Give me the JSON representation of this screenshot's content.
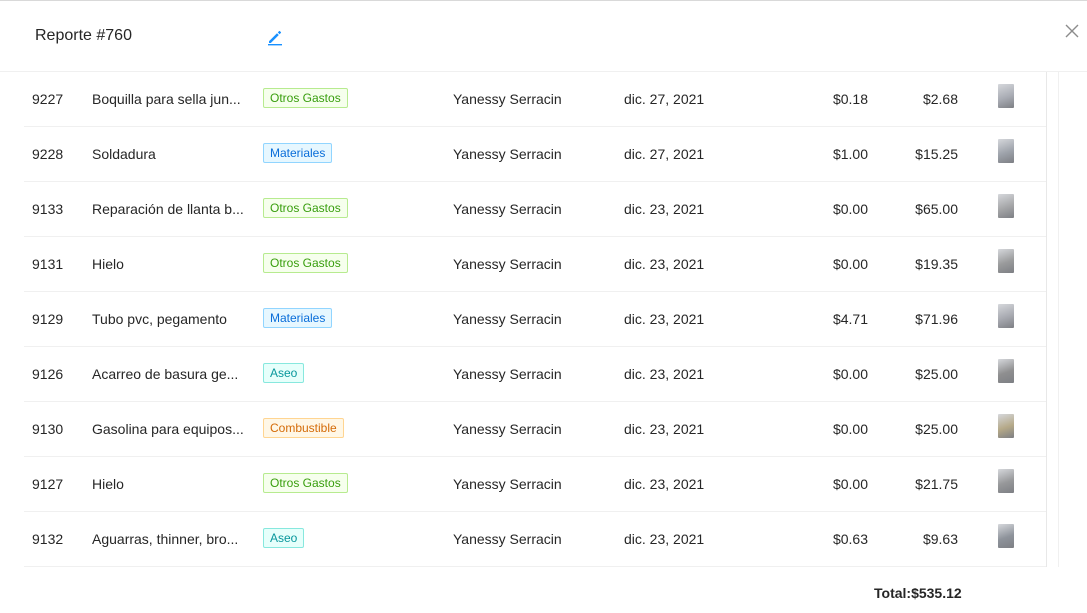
{
  "modal": {
    "title": "Reporte #760",
    "total_label": "Total:",
    "total_value": "$535.12"
  },
  "rows": [
    {
      "id": "9227",
      "desc": "Boquilla para sella jun...",
      "tag": "Otros Gastos",
      "tag_color": "green",
      "user": "Yanessy Serracin",
      "date": "dic. 27, 2021",
      "tax": "$0.18",
      "total": "$2.68",
      "thumb_color": "#a9acb4"
    },
    {
      "id": "9228",
      "desc": "Soldadura",
      "tag": "Materiales",
      "tag_color": "blue",
      "user": "Yanessy Serracin",
      "date": "dic. 27, 2021",
      "tax": "$1.00",
      "total": "$15.25",
      "thumb_color": "#9ea3ab"
    },
    {
      "id": "9133",
      "desc": "Reparación de llanta b...",
      "tag": "Otros Gastos",
      "tag_color": "green",
      "user": "Yanessy Serracin",
      "date": "dic. 23, 2021",
      "tax": "$0.00",
      "total": "$65.00",
      "thumb_color": "#a5a6a8"
    },
    {
      "id": "9131",
      "desc": "Hielo",
      "tag": "Otros Gastos",
      "tag_color": "green",
      "user": "Yanessy Serracin",
      "date": "dic. 23, 2021",
      "tax": "$0.00",
      "total": "$19.35",
      "thumb_color": "#9a9b9c"
    },
    {
      "id": "9129",
      "desc": "Tubo pvc, pegamento",
      "tag": "Materiales",
      "tag_color": "blue",
      "user": "Yanessy Serracin",
      "date": "dic. 23, 2021",
      "tax": "$4.71",
      "total": "$71.96",
      "thumb_color": "#a7a9b0"
    },
    {
      "id": "9126",
      "desc": "Acarreo de basura ge...",
      "tag": "Aseo",
      "tag_color": "cyan",
      "user": "Yanessy Serracin",
      "date": "dic. 23, 2021",
      "tax": "$0.00",
      "total": "$25.00",
      "thumb_color": "#8f8f90"
    },
    {
      "id": "9130",
      "desc": "Gasolina para equipos...",
      "tag": "Combustible",
      "tag_color": "orange",
      "user": "Yanessy Serracin",
      "date": "dic. 23, 2021",
      "tax": "$0.00",
      "total": "$25.00",
      "thumb_color": "#b5a988"
    },
    {
      "id": "9127",
      "desc": "Hielo",
      "tag": "Otros Gastos",
      "tag_color": "green",
      "user": "Yanessy Serracin",
      "date": "dic. 23, 2021",
      "tax": "$0.00",
      "total": "$21.75",
      "thumb_color": "#97989a"
    },
    {
      "id": "9132",
      "desc": "Aguarras, thinner, bro...",
      "tag": "Aseo",
      "tag_color": "cyan",
      "user": "Yanessy Serracin",
      "date": "dic. 23, 2021",
      "tax": "$0.63",
      "total": "$9.63",
      "thumb_color": "#8e939b"
    }
  ],
  "icons": {
    "edit": "edit-icon",
    "close": "close-icon"
  },
  "colors": {
    "accent": "#1890ff",
    "text": "#262626"
  }
}
